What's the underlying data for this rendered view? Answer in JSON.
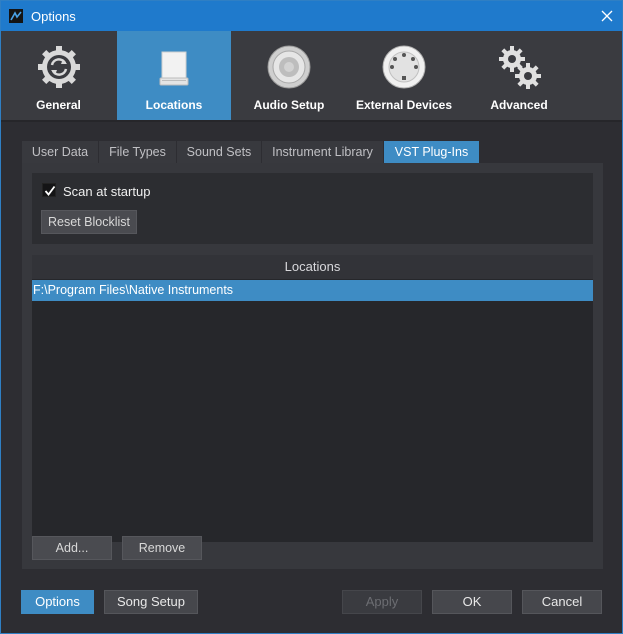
{
  "window": {
    "title": "Options",
    "accent_color": "#1f7acc"
  },
  "categories": [
    {
      "label": "General",
      "icon": "sync-gear-icon"
    },
    {
      "label": "Locations",
      "icon": "drive-icon"
    },
    {
      "label": "Audio Setup",
      "icon": "speaker-icon"
    },
    {
      "label": "External Devices",
      "icon": "midi-port-icon"
    },
    {
      "label": "Advanced",
      "icon": "gears-icon"
    }
  ],
  "active_category": "Locations",
  "tabs": [
    {
      "label": "User Data"
    },
    {
      "label": "File Types"
    },
    {
      "label": "Sound Sets"
    },
    {
      "label": "Instrument Library"
    },
    {
      "label": "VST Plug-Ins"
    }
  ],
  "active_tab": "VST Plug-Ins",
  "vst": {
    "scan_label": "Scan at startup",
    "scan_checked": true,
    "reset_label": "Reset Blocklist",
    "list_header": "Locations",
    "locations": [
      "F:\\Program Files\\Native Instruments"
    ],
    "add_label": "Add...",
    "remove_label": "Remove"
  },
  "footer": {
    "options_label": "Options",
    "song_setup_label": "Song Setup",
    "apply_label": "Apply",
    "ok_label": "OK",
    "cancel_label": "Cancel"
  }
}
